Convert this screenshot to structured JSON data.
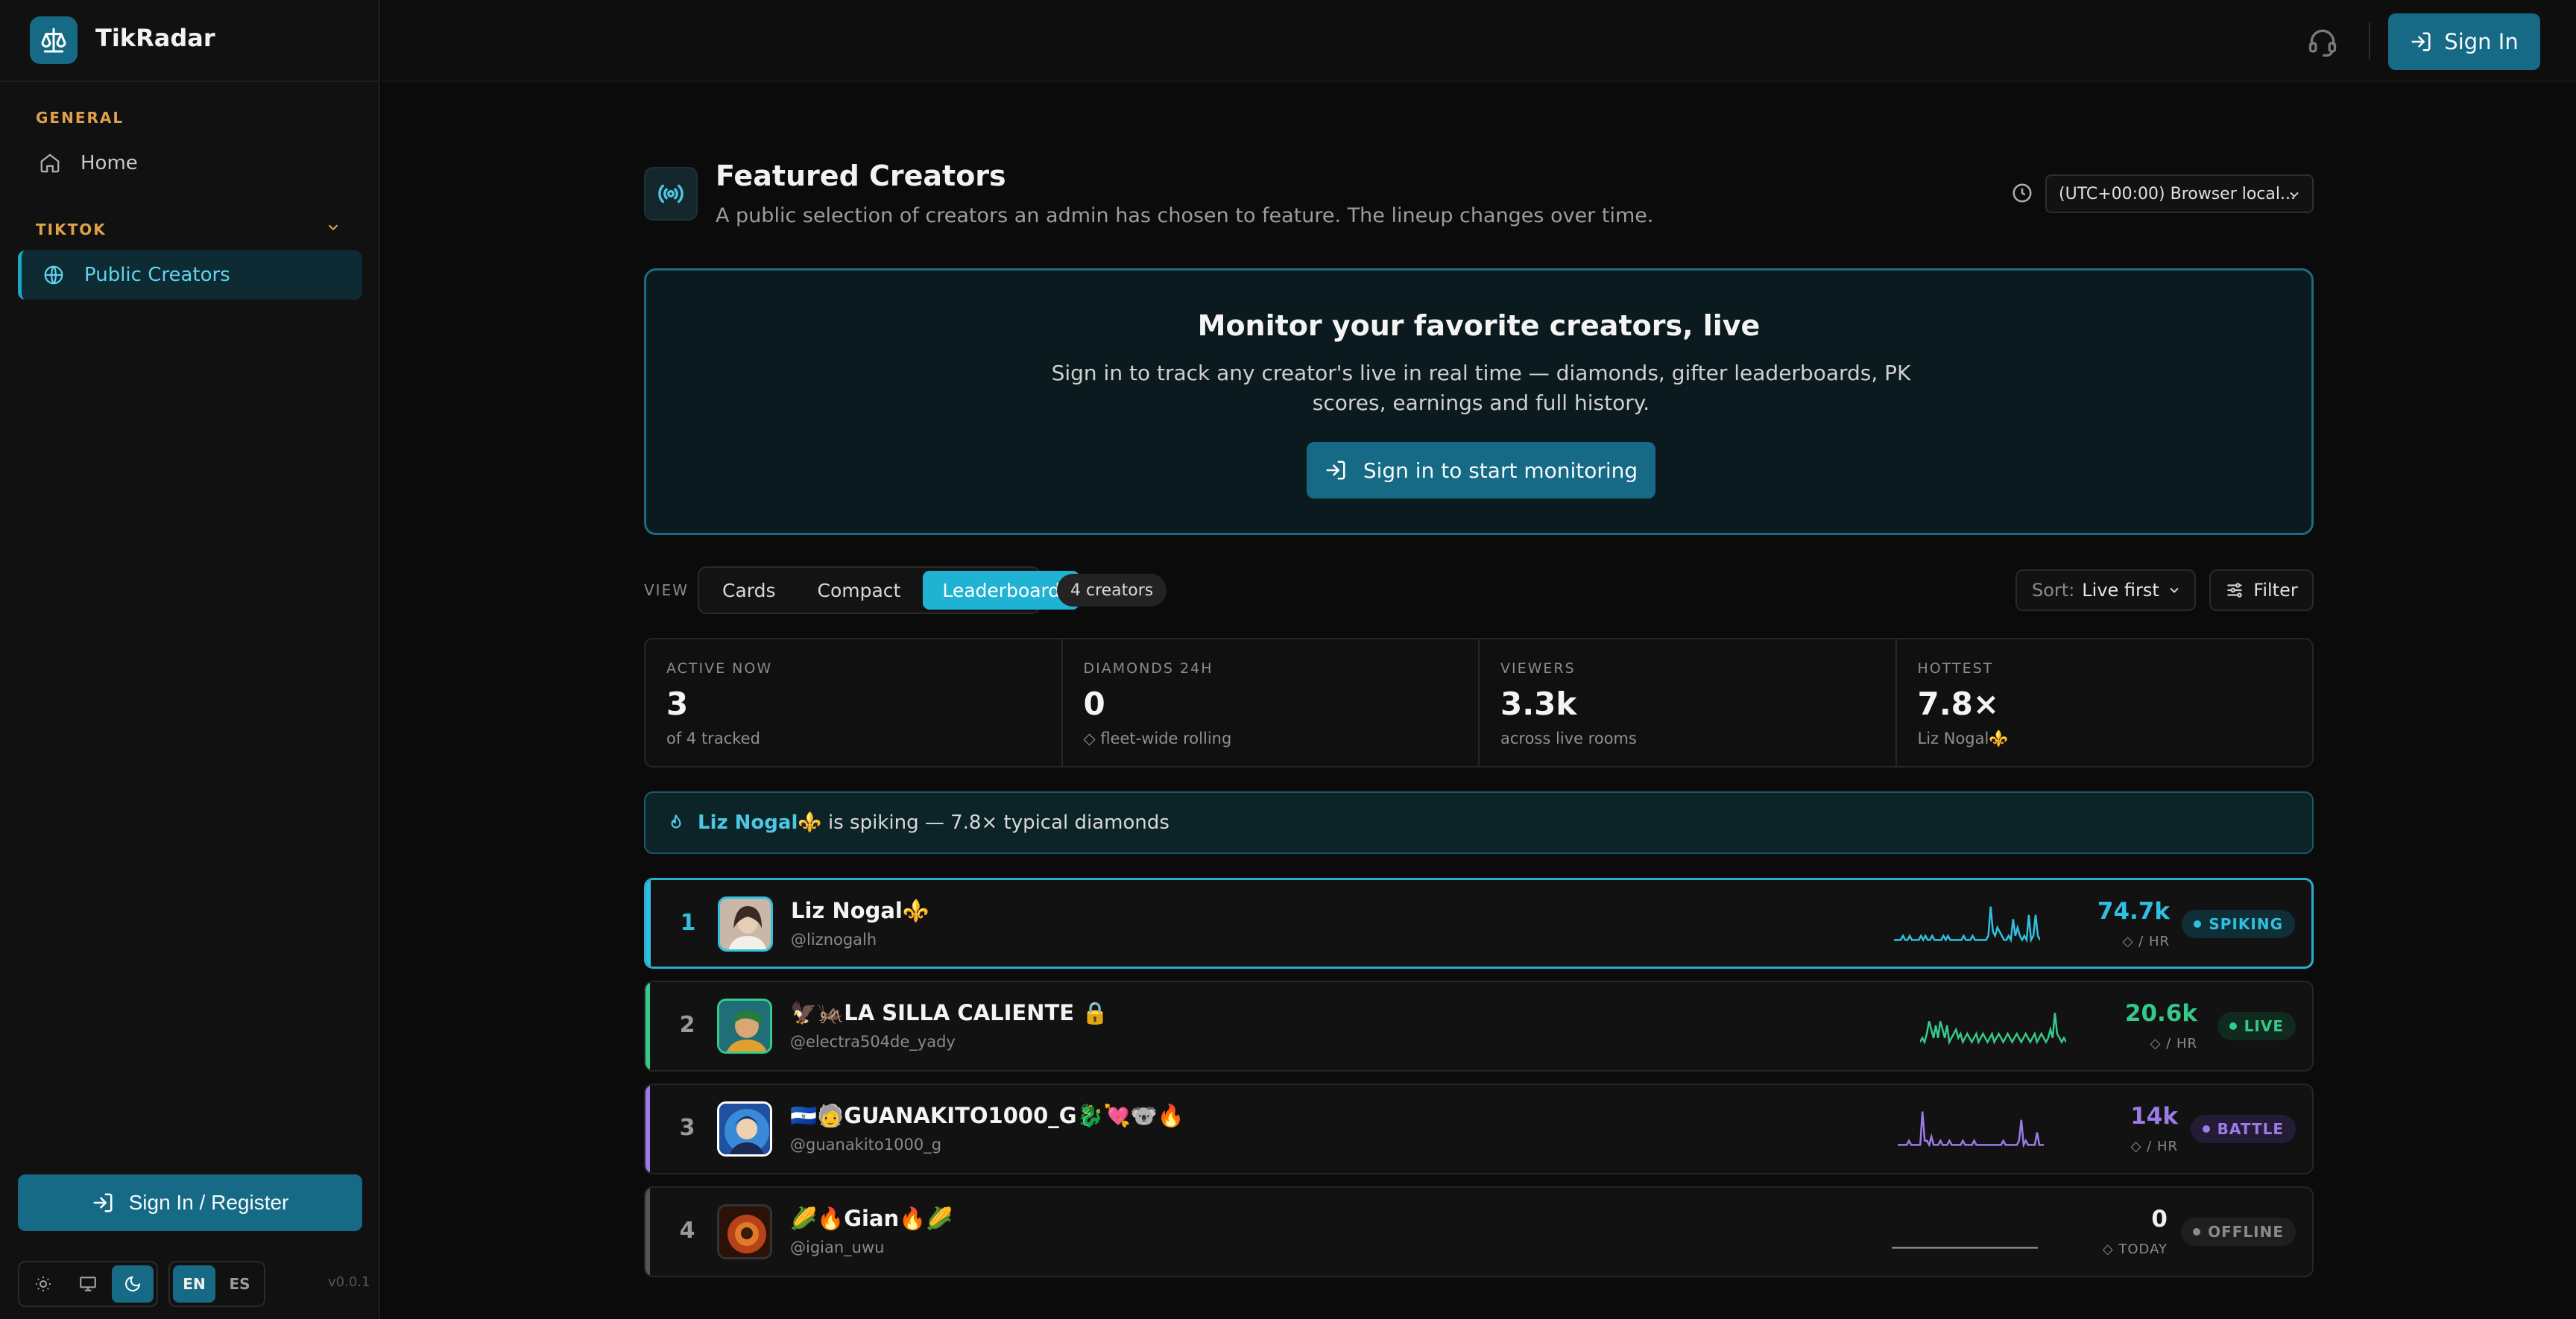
{
  "app": {
    "name": "TikRadar",
    "version": "v0.0.1"
  },
  "sidebar": {
    "sections": [
      {
        "label": "GENERAL",
        "items": [
          {
            "label": "Home",
            "icon": "home-icon"
          }
        ]
      },
      {
        "label": "TIKTOK",
        "items": [
          {
            "label": "Public Creators",
            "icon": "globe-icon",
            "active": true
          }
        ]
      }
    ],
    "signin_register": "Sign In / Register",
    "theme_options": [
      "light",
      "system",
      "dark"
    ],
    "languages": [
      "EN",
      "ES"
    ]
  },
  "topbar": {
    "signin_label": "Sign In"
  },
  "page": {
    "title": "Featured Creators",
    "subtitle": "A public selection of creators an admin has chosen to feature. The lineup changes over time.",
    "timezone": "(UTC+00:00) Browser local..."
  },
  "promo": {
    "title": "Monitor your favorite creators, live",
    "text": "Sign in to track any creator's live in real time — diamonds, gifter leaderboards, PK scores, earnings and full history.",
    "button": "Sign in to start monitoring"
  },
  "controls": {
    "view_label": "VIEW",
    "views": [
      "Cards",
      "Compact",
      "Leaderboard"
    ],
    "active_view": "Leaderboard",
    "count": "4 creators",
    "sort_label": "Sort:",
    "sort_value": "Live first",
    "filter_label": "Filter"
  },
  "stats": [
    {
      "label": "ACTIVE NOW",
      "value": "3",
      "sub": "of 4 tracked"
    },
    {
      "label": "DIAMONDS 24H",
      "value": "0",
      "sub": "◇ fleet-wide rolling"
    },
    {
      "label": "VIEWERS",
      "value": "3.3k",
      "sub": "across live rooms"
    },
    {
      "label": "HOTTEST",
      "value": "7.8×",
      "sub": "Liz Nogal⚜️"
    }
  ],
  "alert": {
    "name": "Liz Nogal⚜️",
    "text": "is spiking — 7.8× typical diamonds"
  },
  "creators": [
    {
      "rank": "1",
      "name": "Liz Nogal⚜️",
      "handle": "@liznogalh",
      "rate": "74.7k",
      "unit": "◇ / HR",
      "status": "SPIKING",
      "color": "#2fc0e0",
      "badge_bg": "#0f2e36",
      "spark": [
        1,
        1,
        1,
        1,
        2,
        1,
        1,
        2,
        1,
        1,
        1,
        1,
        2,
        1,
        2,
        1,
        1,
        2,
        1,
        1,
        1,
        1,
        2,
        1,
        2,
        1,
        1,
        1,
        1,
        1,
        1,
        2,
        1,
        1,
        1,
        2,
        1,
        1,
        1,
        1,
        1,
        1,
        2,
        9,
        3,
        2,
        4,
        3,
        2,
        1,
        1,
        2,
        1,
        6,
        2,
        4,
        2,
        1,
        2,
        1,
        7,
        1,
        2,
        7,
        2,
        1
      ]
    },
    {
      "rank": "2",
      "name": "🦅🦗LA SILLA CALIENTE 🔒",
      "handle": "@electra504de_yady",
      "rate": "20.6k",
      "unit": "◇ / HR",
      "status": "LIVE",
      "color": "#35c98a",
      "badge_bg": "#102a20",
      "spark": [
        1,
        2,
        1,
        3,
        6,
        4,
        2,
        5,
        2,
        6,
        4,
        2,
        5,
        1,
        2,
        3,
        4,
        2,
        3,
        1,
        2,
        3,
        2,
        1,
        2,
        3,
        1,
        2,
        3,
        2,
        1,
        2,
        3,
        1,
        2,
        3,
        2,
        1,
        2,
        3,
        2,
        1,
        2,
        3,
        2,
        1,
        2,
        3,
        2,
        1,
        2,
        3,
        1,
        2,
        3,
        2,
        1,
        2,
        4,
        2,
        8,
        3,
        2,
        1,
        2,
        1
      ]
    },
    {
      "rank": "3",
      "name": "🇸🇻🧓GUANAKITO1000_G🐉💘🐨🔥",
      "handle": "@guanakito1000_g",
      "rate": "14k",
      "unit": "◇ / HR",
      "status": "BATTLE",
      "color": "#9b7be8",
      "badge_bg": "#241c36",
      "spark": [
        1,
        1,
        1,
        1,
        1,
        2,
        1,
        1,
        1,
        1,
        1,
        9,
        2,
        2,
        1,
        3,
        1,
        1,
        1,
        2,
        1,
        1,
        1,
        2,
        1,
        1,
        1,
        1,
        1,
        2,
        1,
        1,
        1,
        1,
        2,
        1,
        1,
        1,
        1,
        1,
        1,
        1,
        1,
        1,
        1,
        1,
        1,
        2,
        1,
        1,
        1,
        1,
        1,
        1,
        2,
        7,
        1,
        2,
        1,
        1,
        1,
        1,
        4,
        1,
        1,
        1
      ]
    },
    {
      "rank": "4",
      "name": "🌽🔥Gian🔥🌽",
      "handle": "@igian_uwu",
      "rate": "0",
      "unit": "◇ TODAY",
      "status": "OFFLINE",
      "color": "#8a8a8a",
      "badge_bg": "#1f1f1f",
      "spark": [
        1,
        1,
        1,
        1,
        1,
        1,
        1,
        1,
        1,
        1,
        1,
        1,
        1,
        1,
        1,
        1,
        1,
        1,
        1,
        1,
        1,
        1,
        1,
        1,
        1,
        1,
        1,
        1,
        1,
        1,
        1,
        1,
        1,
        1,
        1,
        1,
        1,
        1,
        1,
        1,
        1,
        1,
        1,
        1,
        1,
        1,
        1,
        1,
        1,
        1,
        1,
        1,
        1,
        1,
        1,
        1,
        1,
        1,
        1,
        1,
        1,
        1,
        1,
        1,
        1,
        1
      ]
    }
  ]
}
